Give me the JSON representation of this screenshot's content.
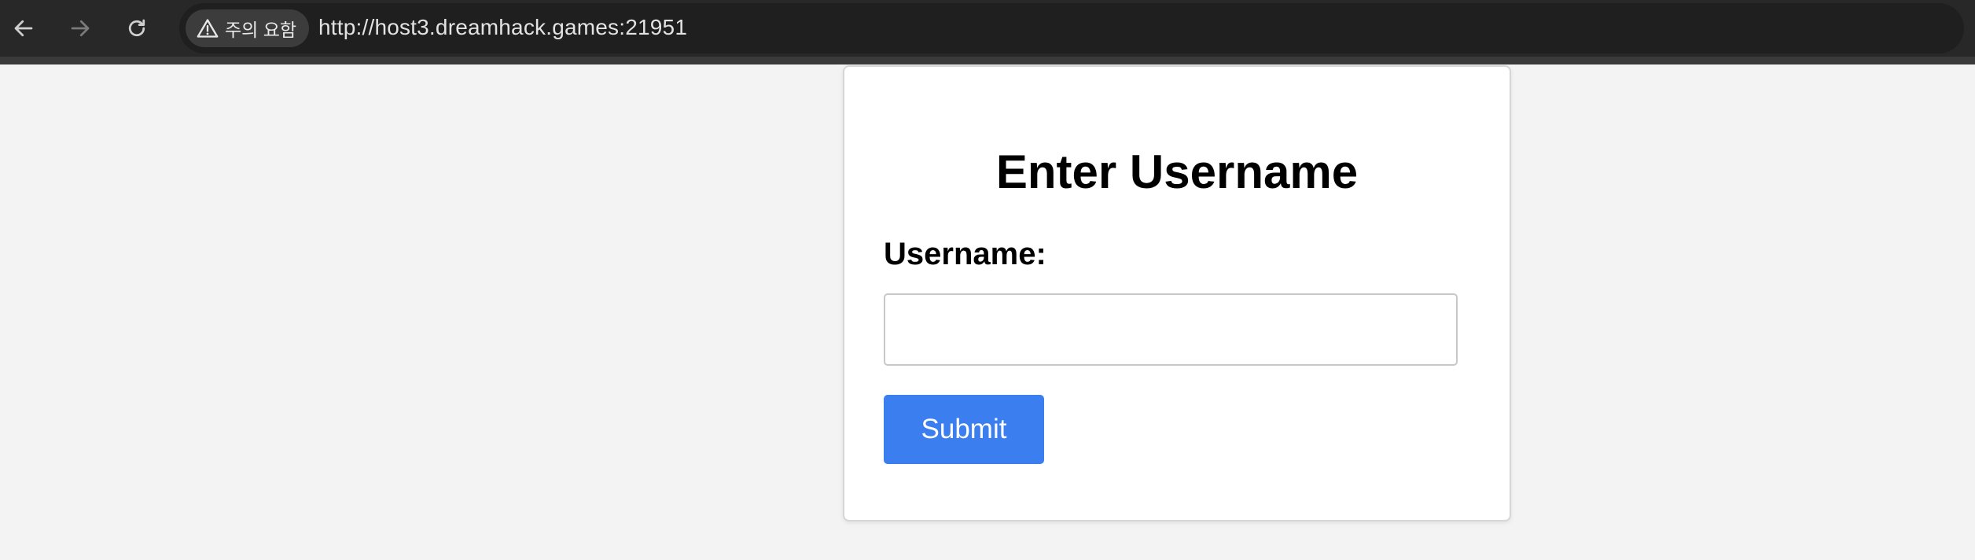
{
  "browser": {
    "back_icon": "arrow-left-icon",
    "forward_icon": "arrow-right-icon",
    "reload_icon": "reload-icon",
    "security_icon": "warning-triangle-icon",
    "security_label": "주의 요함",
    "url": "http://host3.dreamhack.games:21951"
  },
  "form": {
    "title": "Enter Username",
    "username_label": "Username:",
    "username_value": "",
    "submit_label": "Submit"
  },
  "colors": {
    "page_background": "#f3f3f3",
    "toolbar_background": "#282828",
    "submit_button": "#3b7ef0",
    "card_background": "#ffffff"
  }
}
